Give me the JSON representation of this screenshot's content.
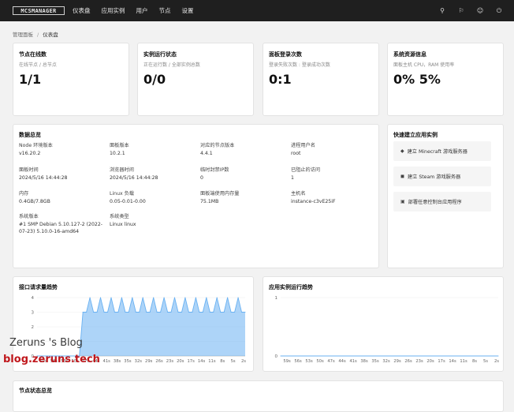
{
  "topbar": {
    "logo": "MCSMANAGER",
    "nav": [
      "仪表盘",
      "应用实例",
      "用户",
      "节点",
      "设置"
    ],
    "icons": [
      "palette-icon",
      "language-icon",
      "user-icon",
      "logout-icon"
    ]
  },
  "breadcrumb": {
    "root": "管理面板",
    "sep": "/",
    "current": "仪表盘"
  },
  "stats": [
    {
      "title": "节点在线数",
      "sub": "在线节点 / 总节点",
      "value": "1/1"
    },
    {
      "title": "实例运行状态",
      "sub": "正在运行数 / 全部实例总数",
      "value": "0/0"
    },
    {
      "title": "面板登录次数",
      "sub": "登录失败次数 : 登录成功次数",
      "value": "0:1"
    },
    {
      "title": "系统资源信息",
      "sub": "面板主机 CPU，RAM 使用率",
      "value": "0% 5%"
    }
  ],
  "overview": {
    "title": "数据总览",
    "items": [
      {
        "label": "Node 环境版本",
        "value": "v16.20.2"
      },
      {
        "label": "面板版本",
        "value": "10.2.1"
      },
      {
        "label": "对应的节点版本",
        "value": "4.4.1"
      },
      {
        "label": "进程用户名",
        "value": "root"
      },
      {
        "label": "面板时间",
        "value": "2024/5/16 14:44:28"
      },
      {
        "label": "浏览器时间",
        "value": "2024/5/16 14:44:28"
      },
      {
        "label": "临时封禁IP数",
        "value": "0"
      },
      {
        "label": "已阻止的访问",
        "value": "1"
      },
      {
        "label": "内存",
        "value": "0.4GB/7.8GB"
      },
      {
        "label": "Linux 负载",
        "value": "0.05-0.01-0.00"
      },
      {
        "label": "面板端使用内存量",
        "value": "75.1MB"
      },
      {
        "label": "主机名",
        "value": "instance-c3vE25iF"
      },
      {
        "label": "系统版本",
        "value": "#1 SMP Debian 5.10.127-2 (2022-07-23) 5.10.0-16-amd64"
      },
      {
        "label": "系统类型",
        "value": "Linux linux"
      }
    ]
  },
  "quick": {
    "title": "快速建立应用实例",
    "buttons": [
      "建立 Minecraft 游戏服务器",
      "建立 Steam 游戏服务器",
      "部署任意控制台应用程序"
    ]
  },
  "chart_data": [
    {
      "type": "area",
      "title": "接口请求量趋势",
      "ylim": [
        0,
        4
      ],
      "yticks": [
        "4",
        "3",
        "2",
        "1",
        "0"
      ],
      "xticks": [
        "59s",
        "56s",
        "53s",
        "50s",
        "47s",
        "44s",
        "41s",
        "38s",
        "35s",
        "32s",
        "29s",
        "26s",
        "23s",
        "20s",
        "17s",
        "14s",
        "11s",
        "8s",
        "5s",
        "2s"
      ],
      "x": [
        "60s",
        "59s",
        "58s",
        "57s",
        "56s",
        "55s",
        "54s",
        "53s",
        "52s",
        "51s",
        "50s",
        "49s",
        "48s",
        "47s",
        "46s",
        "45s",
        "44s",
        "43s",
        "42s",
        "41s",
        "40s",
        "39s",
        "38s",
        "37s",
        "36s",
        "35s",
        "34s",
        "33s",
        "32s",
        "31s",
        "30s",
        "29s",
        "28s",
        "27s",
        "26s",
        "25s",
        "24s",
        "23s",
        "22s",
        "21s",
        "20s",
        "19s",
        "18s",
        "17s",
        "16s",
        "15s",
        "14s",
        "13s",
        "12s",
        "11s",
        "10s",
        "9s",
        "8s",
        "7s",
        "6s",
        "5s",
        "4s",
        "3s",
        "2s",
        "1s"
      ],
      "values": [
        0,
        0,
        0,
        0,
        0,
        0,
        0,
        0,
        0,
        0,
        0,
        0,
        0,
        3,
        3,
        4,
        3,
        3,
        4,
        3,
        3,
        4,
        3,
        3,
        4,
        3,
        3,
        4,
        3,
        3,
        4,
        3,
        3,
        4,
        3,
        3,
        4,
        3,
        3,
        4,
        3,
        3,
        4,
        3,
        3,
        4,
        3,
        3,
        4,
        3,
        3,
        4,
        3,
        3,
        4,
        3,
        3,
        4,
        3,
        3
      ],
      "color": "#69b1f2"
    },
    {
      "type": "line",
      "title": "应用实例运行趋势",
      "ylim": [
        0,
        1
      ],
      "yticks": [
        "1",
        "0"
      ],
      "xticks": [
        "59s",
        "56s",
        "53s",
        "50s",
        "47s",
        "44s",
        "41s",
        "38s",
        "35s",
        "32s",
        "29s",
        "26s",
        "23s",
        "20s",
        "17s",
        "14s",
        "11s",
        "8s",
        "5s",
        "2s"
      ],
      "values": [
        0,
        0,
        0,
        0,
        0,
        0,
        0,
        0,
        0,
        0,
        0,
        0,
        0,
        0,
        0,
        0,
        0,
        0,
        0,
        0,
        0,
        0,
        0,
        0,
        0,
        0,
        0,
        0,
        0,
        0,
        0,
        0,
        0,
        0,
        0,
        0,
        0,
        0,
        0,
        0,
        0,
        0,
        0,
        0,
        0,
        0,
        0,
        0,
        0,
        0,
        0,
        0,
        0,
        0,
        0,
        0,
        0,
        0,
        0,
        0
      ],
      "color": "#69b1f2"
    }
  ],
  "bottom": {
    "title": "节点状态总览"
  },
  "watermark": {
    "line1": "Zeruns 's Blog",
    "line2": "blog.zeruns.tech"
  }
}
